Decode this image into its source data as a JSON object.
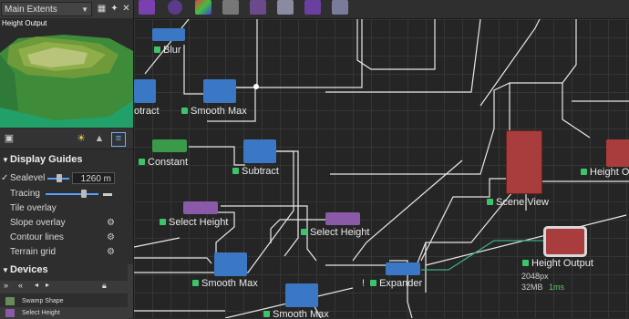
{
  "left_panel": {
    "extents": "Main Extents",
    "preview_label": "Height Output",
    "display_guides": {
      "title": "Display Guides",
      "sealevel_label": "Sealevel",
      "sealevel_value": "1260 m",
      "sealevel_fraction": 0.55,
      "tracing_label": "Tracing",
      "tracing_fraction": 0.72,
      "items": [
        "Tile overlay",
        "Slope overlay",
        "Contour lines",
        "Terrain grid"
      ]
    },
    "devices": {
      "title": "Devices",
      "items": [
        "Swamp Shape",
        "Select Height"
      ]
    }
  },
  "canvas": {
    "nodes": {
      "blur": "Blur",
      "subtract_left": "otract",
      "smooth_max_1": "Smooth Max",
      "constant": "Constant",
      "subtract": "Subtract",
      "select_height_1": "Select Height",
      "select_height_2": "Select Height",
      "smooth_max_2": "Smooth Max",
      "smooth_max_3": "Smooth Max",
      "expander": "Expander",
      "scene_view": "Scene View",
      "height_output": "Height Output",
      "height_output_right": "Height O"
    },
    "height_output_size": "2048px",
    "height_output_mem": "32MB",
    "height_output_time": "1ms"
  },
  "colors": {
    "blue_node": "#3a77c4",
    "green_node": "#3a9a4a",
    "purple_node": "#8a5aa8",
    "red_node": "#a93c3c",
    "status_dot": "#3cc46a"
  }
}
